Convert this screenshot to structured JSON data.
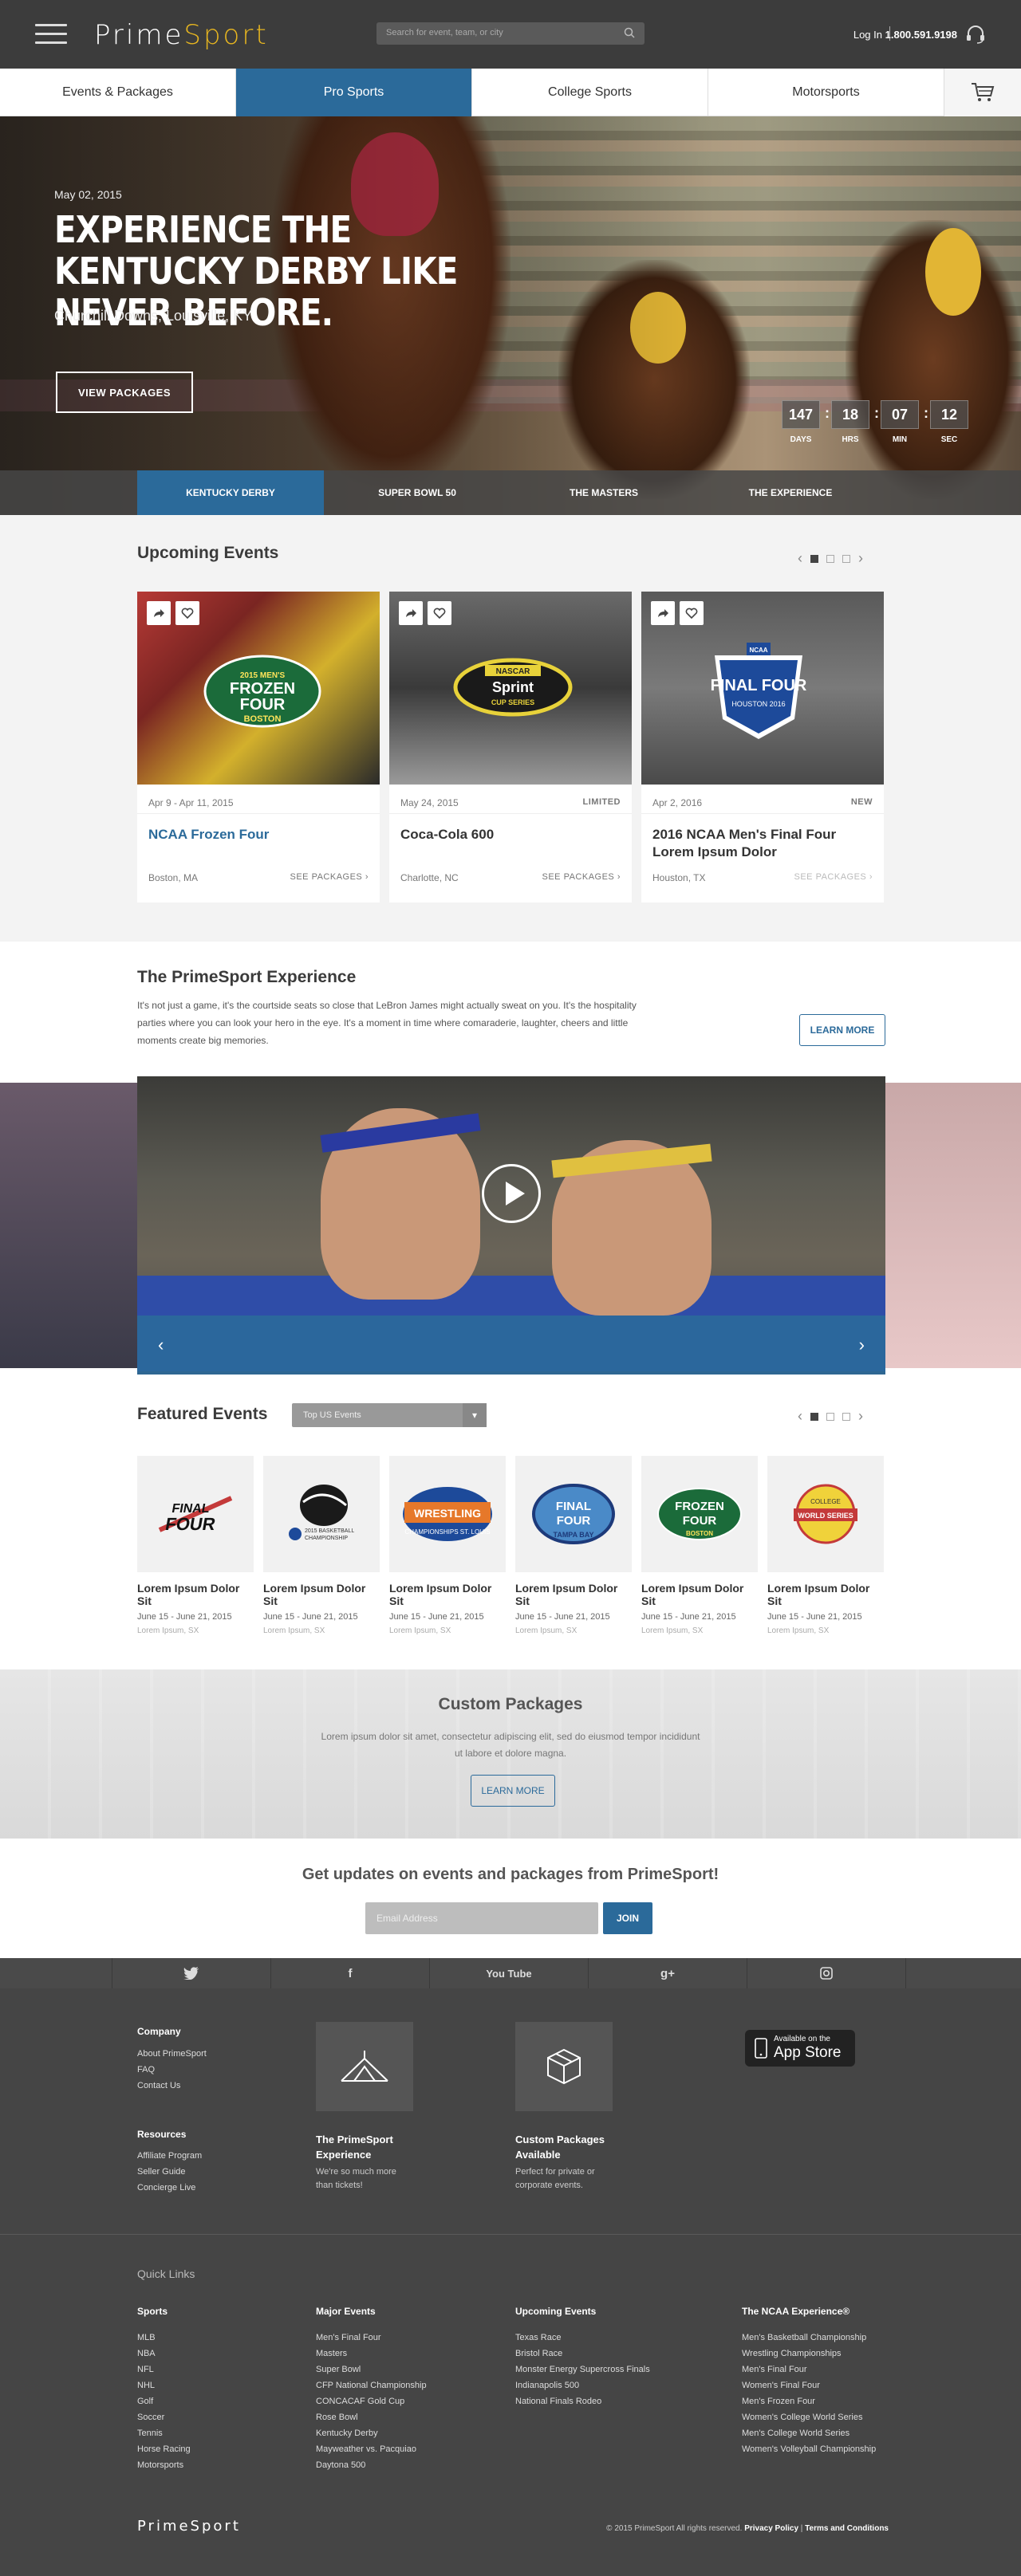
{
  "header": {
    "logo_prime": "Prime",
    "logo_sport": "Sport",
    "search_placeholder": "Search for event, team, or city",
    "login": "Log In",
    "phone": "1.800.591.9198"
  },
  "nav": {
    "items": [
      "Events & Packages",
      "Pro Sports",
      "College Sports",
      "Motorsports"
    ],
    "active": 1
  },
  "hero": {
    "date": "May 02, 2015",
    "title": "EXPERIENCE THE KENTUCKY DERBY LIKE NEVER BEFORE.",
    "location": "Churchill Downs, Louisville, KY",
    "button": "VIEW PACKAGES",
    "countdown": [
      {
        "value": "147",
        "label": "DAYS"
      },
      {
        "value": "18",
        "label": "HRS"
      },
      {
        "value": "07",
        "label": "MIN"
      },
      {
        "value": "12",
        "label": "SEC"
      }
    ],
    "tabs": [
      "KENTUCKY DERBY",
      "SUPER BOWL 50",
      "THE MASTERS",
      "THE EXPERIENCE"
    ]
  },
  "upcoming": {
    "title": "Upcoming Events",
    "cards": [
      {
        "date": "Apr 9 - Apr 11, 2015",
        "tag": "",
        "name": "NCAA Frozen Four",
        "location": "Boston, MA",
        "link": "SEE PACKAGES ›",
        "logo": "2015 MEN'S FROZEN FOUR BOSTON"
      },
      {
        "date": "May 24, 2015",
        "tag": "LIMITED",
        "name": "Coca-Cola 600",
        "location": "Charlotte, NC",
        "link": "SEE PACKAGES ›",
        "logo": "NASCAR Sprint CUP SERIES"
      },
      {
        "date": "Apr 2, 2016",
        "tag": "NEW",
        "name": "2016 NCAA Men's Final Four Lorem Ipsum Dolor",
        "location": "Houston, TX",
        "link": "SEE PACKAGES ›",
        "logo": "FINAL FOUR HOUSTON 2016"
      }
    ]
  },
  "experience": {
    "title": "The PrimeSport Experience",
    "text": "It's not just a game, it's the courtside seats so close that LeBron James might actually sweat on you. It's the hospitality parties where you can look your hero in the eye. It's a moment in time where comaraderie, laughter, cheers and little moments create big memories.",
    "button": "LEARN MORE"
  },
  "featured": {
    "title": "Featured Events",
    "select": "Top US Events",
    "items": [
      {
        "name": "Lorem Ipsum Dolor Sit",
        "date": "June 15 - June 21, 2015",
        "location": "Lorem Ipsum, SX",
        "logo": "FINAL FOUR"
      },
      {
        "name": "Lorem Ipsum Dolor Sit",
        "date": "June 15 - June 21, 2015",
        "location": "Lorem Ipsum, SX",
        "logo": "2015 BASKETBALL CHAMPIONSHIP"
      },
      {
        "name": "Lorem Ipsum Dolor Sit",
        "date": "June 15 - June 21, 2015",
        "location": "Lorem Ipsum, SX",
        "logo": "WRESTLING CHAMPIONSHIPS ST. LOUIS"
      },
      {
        "name": "Lorem Ipsum Dolor Sit",
        "date": "June 15 - June 21, 2015",
        "location": "Lorem Ipsum, SX",
        "logo": "FINAL FOUR TAMPA BAY"
      },
      {
        "name": "Lorem Ipsum Dolor Sit",
        "date": "June 15 - June 21, 2015",
        "location": "Lorem Ipsum, SX",
        "logo": "FROZEN FOUR BOSTON"
      },
      {
        "name": "Lorem Ipsum Dolor Sit",
        "date": "June 15 - June 21, 2015",
        "location": "Lorem Ipsum, SX",
        "logo": "COLLEGE WORLD SERIES"
      }
    ]
  },
  "custom": {
    "title": "Custom Packages",
    "text": "Lorem ipsum dolor sit amet, consectetur adipiscing elit, sed do eiusmod tempor incididunt ut labore et dolore magna.",
    "button": "LEARN MORE"
  },
  "newsletter": {
    "title": "Get updates on events and packages from PrimeSport!",
    "placeholder": "Email Address",
    "button": "JOIN"
  },
  "social": [
    "twitter-icon",
    "facebook-icon",
    "youtube-icon",
    "google-plus-icon",
    "instagram-icon"
  ],
  "social_youtube": "You Tube",
  "footer": {
    "company_title": "Company",
    "company_links": [
      "About PrimeSport",
      "FAQ",
      "Contact Us"
    ],
    "resources_title": "Resources",
    "resources_links": [
      "Affiliate Program",
      "Seller Guide",
      "Concierge Live"
    ],
    "exp_title": "The PrimeSport Experience",
    "exp_desc": "We're so much more than tickets!",
    "custom_title": "Custom Packages Available",
    "custom_desc": "Perfect for private or corporate events.",
    "app_line1": "Available on the",
    "app_line2": "App Store",
    "quick_links": "Quick Links",
    "columns": [
      {
        "title": "Sports",
        "links": [
          "MLB",
          "NBA",
          "NFL",
          "NHL",
          "Golf",
          "Soccer",
          "Tennis",
          "Horse Racing",
          "Motorsports"
        ]
      },
      {
        "title": "Major Events",
        "links": [
          "Men's Final Four",
          "Masters",
          "Super Bowl",
          "CFP National Championship",
          "CONCACAF Gold Cup",
          "Rose Bowl",
          "Kentucky Derby",
          "Mayweather vs. Pacquiao",
          "Daytona 500"
        ]
      },
      {
        "title": "Upcoming Events",
        "links": [
          "Texas Race",
          "Bristol Race",
          "Monster Energy Supercross Finals",
          "Indianapolis 500",
          "National Finals Rodeo"
        ]
      },
      {
        "title": "The NCAA Experience®",
        "links": [
          "Men's Basketball Championship",
          "Wrestling Championships",
          "Men's Final Four",
          "Women's Final Four",
          "Men's Frozen Four",
          "Women's College World Series",
          "Men's College World Series",
          "Women's Volleyball Championship"
        ]
      }
    ],
    "logo": "PrimeSport",
    "copyright": "© 2015 PrimeSport All rights reserved.",
    "privacy": "Privacy Policy",
    "terms": "Terms and Conditions"
  }
}
